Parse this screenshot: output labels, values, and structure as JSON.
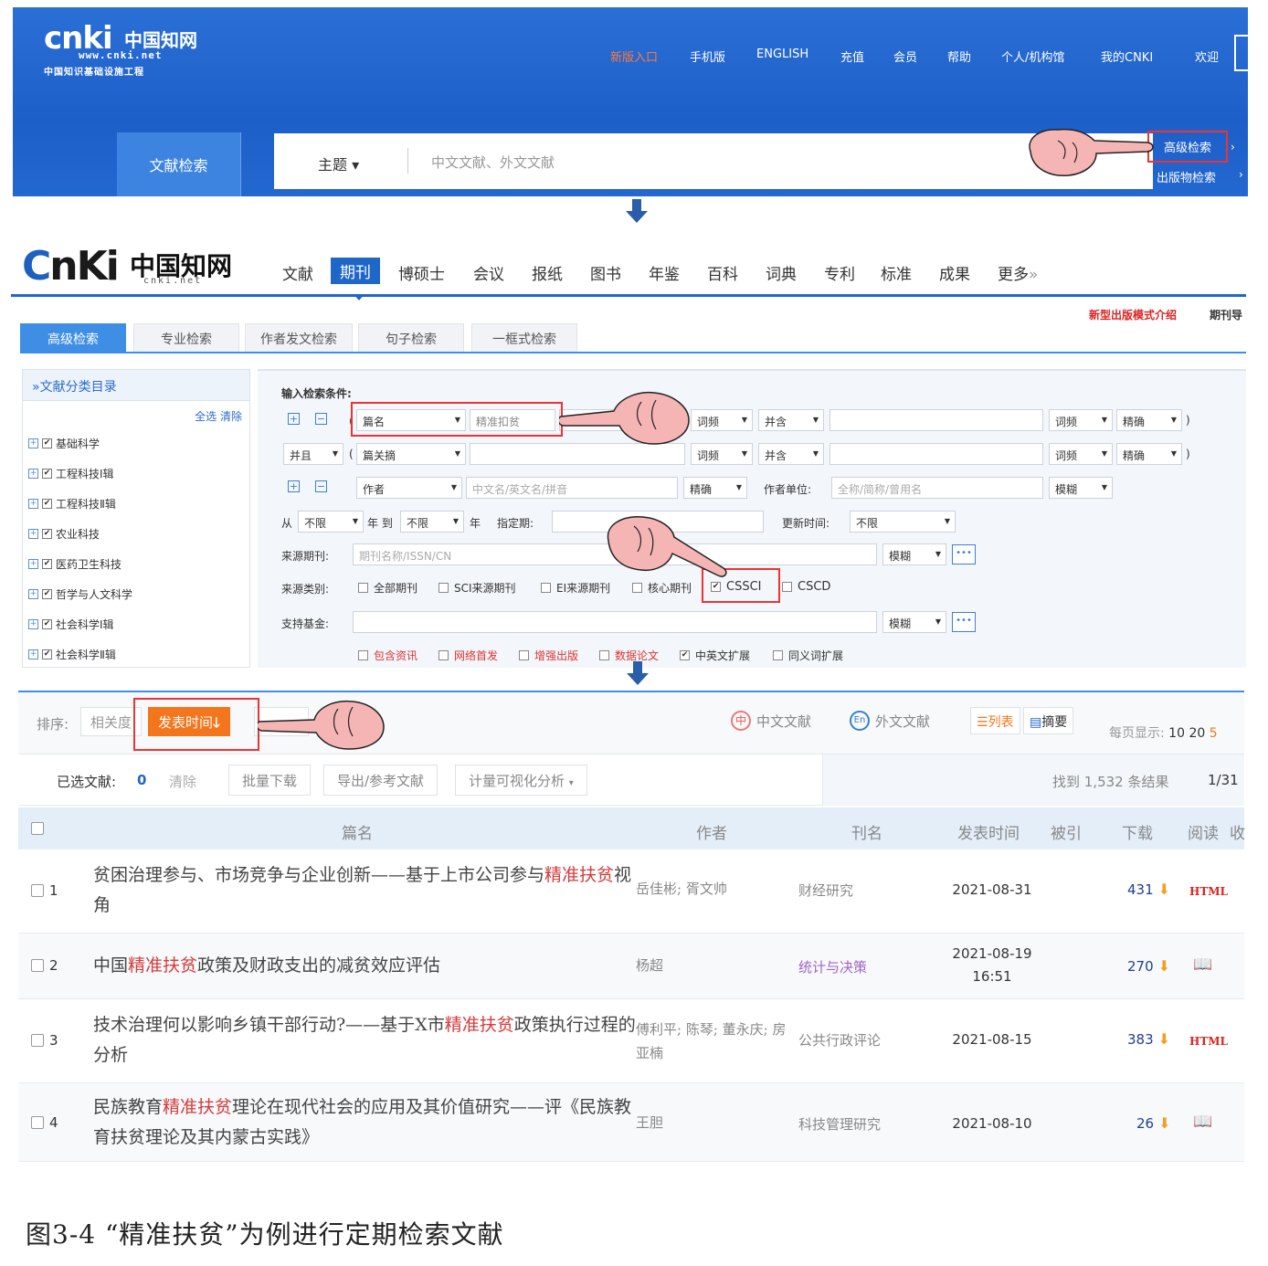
{
  "section1": {
    "logo": {
      "main": "cnki",
      "cn": "中国知网",
      "url": "www.cnki.net",
      "sub": "中国知识基础设施工程"
    },
    "top_nav": [
      "新版入口",
      "手机版",
      "ENGLISH",
      "充值",
      "会员",
      "帮助",
      "个人/机构馆",
      "我的CNKI",
      "欢迎"
    ],
    "search_tab": "文献检索",
    "field_selector": "主题",
    "search_placeholder": "中文文献、外文文献",
    "advanced_search": "高级检索",
    "publication_search": "出版物检索"
  },
  "section2": {
    "logo": {
      "main": "cnki",
      "cn": "中国知网",
      "url": "cnki.net"
    },
    "nav": [
      "文献",
      "期刊",
      "博硕士",
      "会议",
      "报纸",
      "图书",
      "年鉴",
      "百科",
      "词典",
      "专利",
      "标准",
      "成果",
      "更多"
    ],
    "nav_active": "期刊",
    "promo": "新型出版模式介绍",
    "promo2": "期刊导",
    "tabs": [
      "高级检索",
      "专业检索",
      "作者发文检索",
      "句子检索",
      "一框式检索"
    ],
    "category_panel": {
      "title": "文献分类目录",
      "select_all": "全选",
      "clear": "清除",
      "items": [
        "基础科学",
        "工程科技Ⅰ辑",
        "工程科技Ⅱ辑",
        "农业科技",
        "医药卫生科技",
        "哲学与人文科学",
        "社会科学Ⅰ辑",
        "社会科学Ⅱ辑"
      ]
    },
    "form": {
      "heading": "输入检索条件:",
      "row1": {
        "field": "篇名",
        "value": "精准扣贫",
        "freq": "词频",
        "combo": "并含",
        "freq2": "词频",
        "match": "精确"
      },
      "row2": {
        "logic": "并且",
        "field": "篇关摘",
        "freq": "词频",
        "combo": "并含",
        "freq2": "词频",
        "match": "精确"
      },
      "row3": {
        "field": "作者",
        "placeholder": "中文名/英文名/拼音",
        "match": "精确",
        "unit_label": "作者单位:",
        "unit_placeholder": "全称/简称/曾用名",
        "unit_match": "模糊"
      },
      "row4": {
        "from": "从",
        "from_val": "不限",
        "year": "年 到",
        "to_val": "不限",
        "year2": "年",
        "specified": "指定期:",
        "update": "更新时间:",
        "update_val": "不限"
      },
      "source_journal": {
        "label": "来源期刊:",
        "placeholder": "期刊名称/ISSN/CN",
        "match": "模糊"
      },
      "source_type": {
        "label": "来源类别:",
        "options": [
          "全部期刊",
          "SCI来源期刊",
          "EI来源期刊",
          "核心期刊",
          "CSSCI",
          "CSCD"
        ],
        "checked": "CSSCI"
      },
      "fund": {
        "label": "支持基金:",
        "match": "模糊"
      },
      "extras": [
        {
          "label": "包含资讯",
          "red": true,
          "checked": false
        },
        {
          "label": "网络首发",
          "red": true,
          "checked": false
        },
        {
          "label": "增强出版",
          "red": true,
          "checked": false
        },
        {
          "label": "数据论文",
          "red": true,
          "checked": false
        },
        {
          "label": "中英文扩展",
          "red": false,
          "checked": true
        },
        {
          "label": "同义词扩展",
          "red": false,
          "checked": false
        }
      ]
    }
  },
  "section3": {
    "sort_label": "排序:",
    "sort_relevance": "相关度",
    "sort_time": "发表时间",
    "lang_cn": "中文文献",
    "lang_en": "外文文献",
    "view_list": "列表",
    "view_abstract": "摘要",
    "per_page_label": "每页显示:",
    "per_page": [
      "10",
      "20",
      "5"
    ],
    "selected_label": "已选文献:",
    "selected_count": "0",
    "clear": "清除",
    "actions": [
      "批量下载",
      "导出/参考文献",
      "计量可视化分析"
    ],
    "found": "找到 1,532 条结果",
    "page": "1/31",
    "columns": [
      "篇名",
      "作者",
      "刊名",
      "发表时间",
      "被引",
      "下载",
      "阅读",
      "收"
    ],
    "rows": [
      {
        "idx": "1",
        "title_parts": [
          "贫困治理参与、市场竞争与企业创新——基于上市公司参与",
          "精准扶贫",
          "视角"
        ],
        "authors": "岳佳彬; 胥文帅",
        "journal": "财经研究",
        "date": "2021-08-31",
        "time": "",
        "downloads": "431",
        "read": "HTML"
      },
      {
        "idx": "2",
        "title_parts": [
          "中国",
          "精准扶贫",
          "政策及财政支出的减贫效应评估"
        ],
        "authors": "杨超",
        "journal": "统计与决策",
        "date": "2021-08-19",
        "time": "16:51",
        "downloads": "270",
        "read": "book"
      },
      {
        "idx": "3",
        "title_parts": [
          "技术治理何以影响乡镇干部行动?——基于X市",
          "精准扶贫",
          "政策执行过程的分析"
        ],
        "authors": "傅利平; 陈琴; 董永庆; 房亚楠",
        "journal": "公共行政评论",
        "date": "2021-08-15",
        "time": "",
        "downloads": "383",
        "read": "HTML"
      },
      {
        "idx": "4",
        "title_parts": [
          "民族教育",
          "精准扶贫",
          "理论在现代社会的应用及其价值研究——评《民族教育扶贫理论及其内蒙古实践》"
        ],
        "authors": "王胆",
        "journal": "科技管理研究",
        "date": "2021-08-10",
        "time": "",
        "downloads": "26",
        "read": "book"
      }
    ]
  },
  "caption": "图3-4 “精准扶贫”为例进行定期检索文献",
  "colors": {
    "primary_blue": "#1f66c9",
    "highlight_red": "#d43b3b",
    "sort_orange": "#f3761d",
    "annotation_red": "#e33"
  }
}
